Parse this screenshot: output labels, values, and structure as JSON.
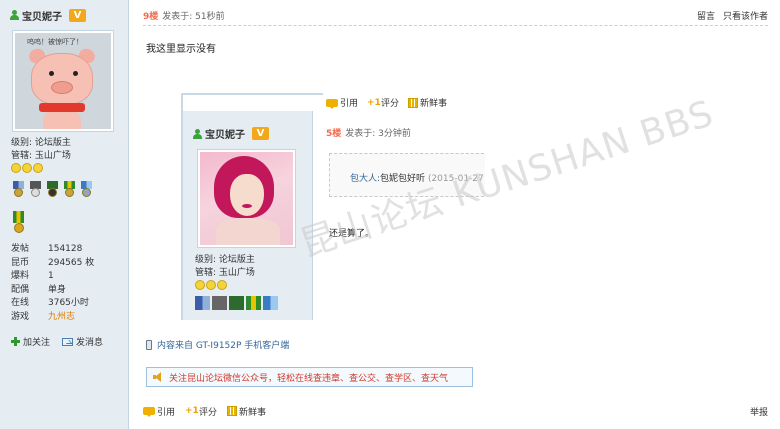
{
  "author": {
    "name": "宝贝妮子",
    "badge": "V",
    "avatar_caption": "呜呜！被惊吓了！",
    "level": "级别: 论坛版主",
    "manage": "管辖: 玉山广场",
    "stats": [
      {
        "label": "发帖",
        "value": "154128"
      },
      {
        "label": "昆币",
        "value": "294565 枚"
      },
      {
        "label": "爆料",
        "value": "1"
      },
      {
        "label": "配偶",
        "value": "单身"
      },
      {
        "label": "在线",
        "value": "3765小时"
      },
      {
        "label": "游戏",
        "value": "九州志"
      }
    ],
    "follow_label": "加关注",
    "message_label": "发消息"
  },
  "post": {
    "floor": "9楼",
    "time": "发表于: 51秒前",
    "reply_label": "留言",
    "only_author_label": "只看该作者",
    "text": "我这里显示没有",
    "source": "内容来自 GT-I9152P 手机客户端",
    "notice": "关注昆山论坛微信公众号，轻松在线查违章、查公交、查学区、查天气",
    "report_label": "举报"
  },
  "toolbar": {
    "quote_label": "引用",
    "rate_label": "评分",
    "fresh_label": "新鲜事"
  },
  "screenshot": {
    "author_name": "宝贝妮子",
    "badge": "V",
    "level": "级别: 论坛版主",
    "manage": "管辖: 玉山广场",
    "floor": "5楼",
    "time": "发表于: 3分钟前",
    "quote_author": "包大人:",
    "quote_text": "包妮包好听",
    "quote_date": "(2015-01-27",
    "reply": "还是算了。"
  },
  "watermark": "昆山论坛 KUNSHAN BBS",
  "colors": {
    "side_bg": "#e5edf2",
    "floor": "#f26c4f",
    "notice_text": "#d0392b",
    "badge": "#f3a81c",
    "link": "#336699"
  }
}
